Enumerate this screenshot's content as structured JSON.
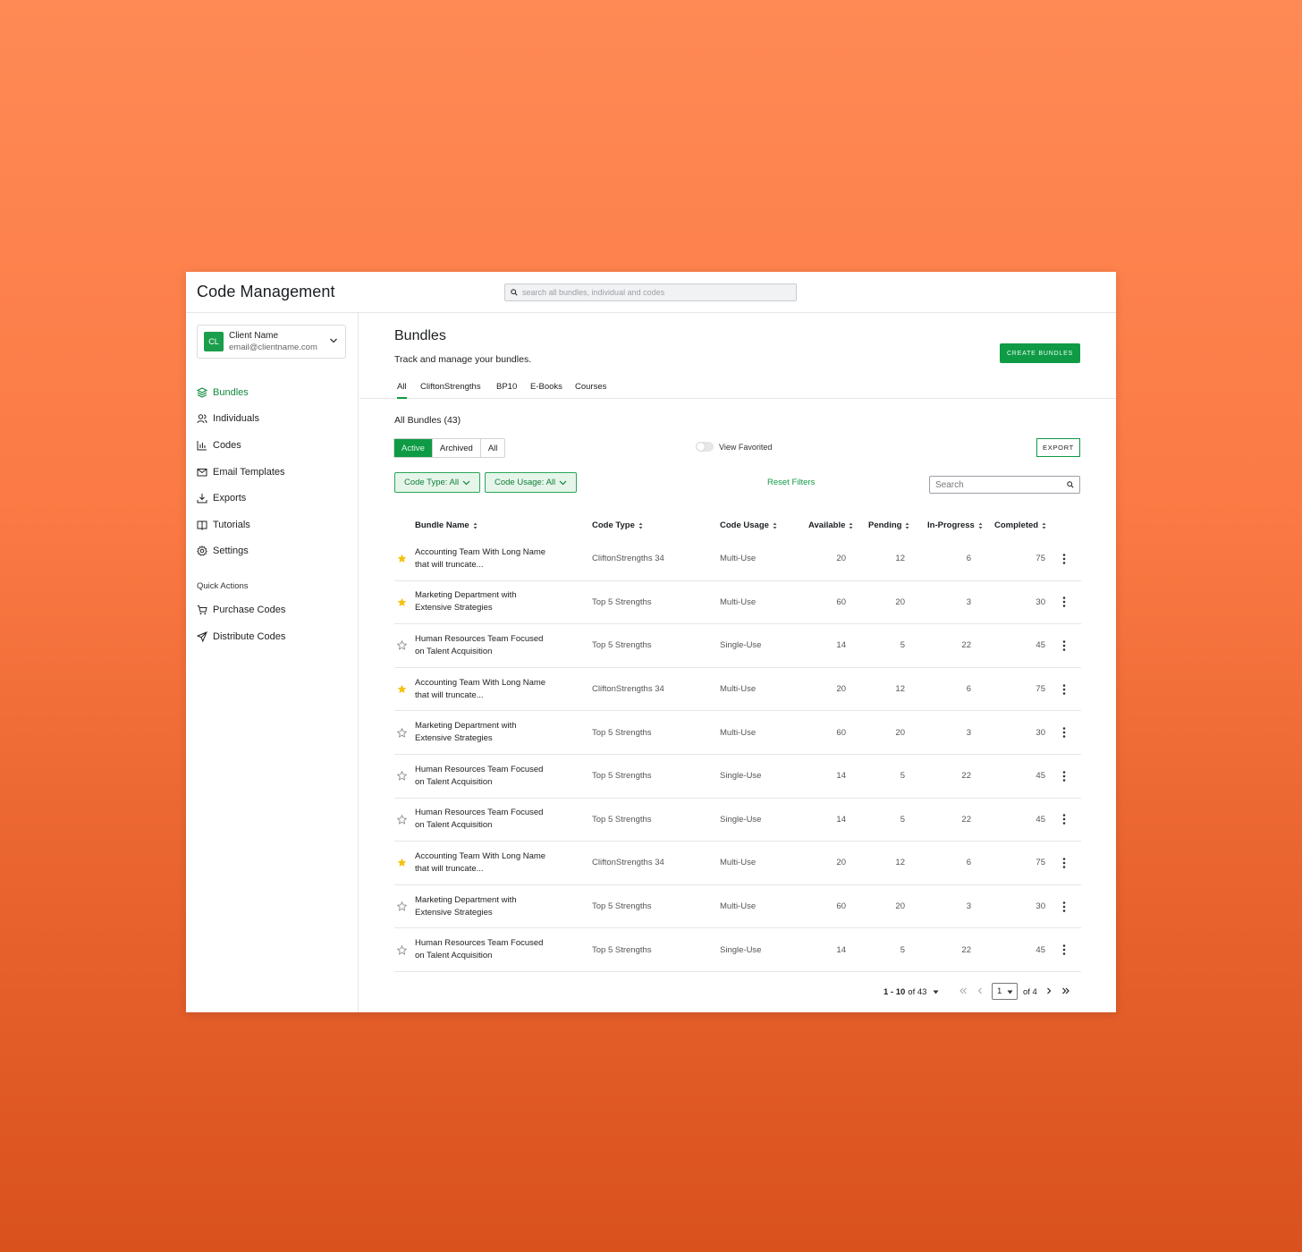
{
  "app": {
    "title": "Code Management",
    "search_placeholder": "search all bundles, individual and codes"
  },
  "client": {
    "initials": "CL",
    "name": "Client Name",
    "email": "email@clientname.com"
  },
  "nav": [
    {
      "label": "Bundles",
      "icon": "layers-icon",
      "active": true
    },
    {
      "label": "Individuals",
      "icon": "users-icon"
    },
    {
      "label": "Codes",
      "icon": "bar-chart-icon"
    },
    {
      "label": "Email Templates",
      "icon": "mail-icon"
    },
    {
      "label": "Exports",
      "icon": "download-icon"
    },
    {
      "label": "Tutorials",
      "icon": "book-icon"
    },
    {
      "label": "Settings",
      "icon": "gear-icon"
    }
  ],
  "quick_actions": {
    "title": "Quick Actions",
    "items": [
      {
        "label": "Purchase Codes",
        "icon": "cart-icon"
      },
      {
        "label": "Distribute Codes",
        "icon": "send-icon"
      }
    ]
  },
  "page": {
    "title": "Bundles",
    "subtitle": "Track and manage your bundles.",
    "create_label": "CREATE BUNDLES",
    "tabs": [
      "All",
      "CliftonStrengths",
      "BP10",
      "E-Books",
      "Courses"
    ],
    "active_tab": "All",
    "count_label": "All Bundles (43)",
    "status_filters": [
      "Active",
      "Archived",
      "All"
    ],
    "active_status": "Active",
    "toggle_label": "View Favorited",
    "export_label": "EXPORT",
    "filter_code_type": "Code Type: All",
    "filter_code_usage": "Code Usage: All",
    "reset_label": "Reset Filters",
    "search_placeholder": "Search"
  },
  "colors": {
    "brand_green": "#0f9a45",
    "star_yellow": "#f5c211",
    "background_orange": "#f77a42"
  },
  "table": {
    "columns": [
      "Bundle Name",
      "Code Type",
      "Code Usage",
      "Available",
      "Pending",
      "In-Progress",
      "Completed"
    ],
    "rows": [
      {
        "fav": true,
        "name1": "Accounting Team With Long Name",
        "name2": "that will truncate...",
        "type": "CliftonStrengths 34",
        "usage": "Multi-Use",
        "available": "20",
        "pending": "12",
        "in_progress": "6",
        "completed": "75"
      },
      {
        "fav": true,
        "name1": "Marketing Department with",
        "name2": "Extensive Strategies",
        "type": "Top 5 Strengths",
        "usage": "Multi-Use",
        "available": "60",
        "pending": "20",
        "in_progress": "3",
        "completed": "30"
      },
      {
        "fav": false,
        "name1": "Human Resources Team Focused",
        "name2": "on Talent Acquisition",
        "type": "Top 5 Strengths",
        "usage": "Single-Use",
        "available": "14",
        "pending": "5",
        "in_progress": "22",
        "completed": "45"
      },
      {
        "fav": true,
        "name1": "Accounting Team With Long Name",
        "name2": "that will truncate...",
        "type": "CliftonStrengths 34",
        "usage": "Multi-Use",
        "available": "20",
        "pending": "12",
        "in_progress": "6",
        "completed": "75"
      },
      {
        "fav": false,
        "name1": "Marketing Department with",
        "name2": "Extensive Strategies",
        "type": "Top 5 Strengths",
        "usage": "Multi-Use",
        "available": "60",
        "pending": "20",
        "in_progress": "3",
        "completed": "30"
      },
      {
        "fav": false,
        "name1": "Human Resources Team Focused",
        "name2": "on Talent Acquisition",
        "type": "Top 5 Strengths",
        "usage": "Single-Use",
        "available": "14",
        "pending": "5",
        "in_progress": "22",
        "completed": "45"
      },
      {
        "fav": false,
        "name1": "Human Resources Team Focused",
        "name2": "on Talent Acquisition",
        "type": "Top 5 Strengths",
        "usage": "Single-Use",
        "available": "14",
        "pending": "5",
        "in_progress": "22",
        "completed": "45"
      },
      {
        "fav": true,
        "name1": "Accounting Team With Long Name",
        "name2": "that will truncate...",
        "type": "CliftonStrengths 34",
        "usage": "Multi-Use",
        "available": "20",
        "pending": "12",
        "in_progress": "6",
        "completed": "75"
      },
      {
        "fav": false,
        "name1": "Marketing Department with",
        "name2": "Extensive Strategies",
        "type": "Top 5 Strengths",
        "usage": "Multi-Use",
        "available": "60",
        "pending": "20",
        "in_progress": "3",
        "completed": "30"
      },
      {
        "fav": false,
        "name1": "Human Resources Team Focused",
        "name2": "on Talent Acquisition",
        "type": "Top 5 Strengths",
        "usage": "Single-Use",
        "available": "14",
        "pending": "5",
        "in_progress": "22",
        "completed": "45"
      }
    ]
  },
  "pagination": {
    "range": "1 - 10",
    "total": "of 43",
    "page": "1",
    "of_pages": "of 4"
  }
}
